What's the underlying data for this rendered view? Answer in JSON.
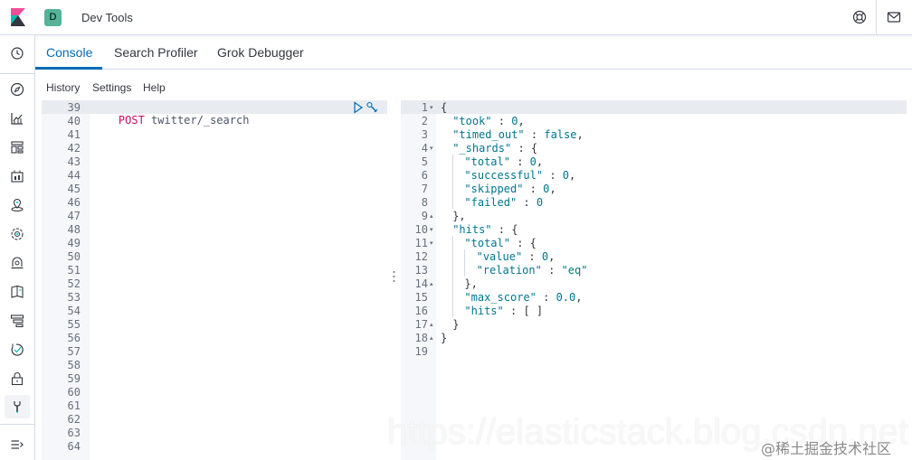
{
  "header": {
    "space_initial": "D",
    "app_title": "Dev Tools",
    "icons": [
      "kibana-logo-icon",
      "help-lifebuoy-icon",
      "mail-icon"
    ]
  },
  "sidebar": {
    "items": [
      {
        "name": "recently-viewed",
        "icon": "clock-icon"
      },
      {
        "name": "discover",
        "icon": "compass-icon"
      },
      {
        "name": "visualize",
        "icon": "chart-icon"
      },
      {
        "name": "dashboard",
        "icon": "dashboard-icon"
      },
      {
        "name": "canvas",
        "icon": "canvas-icon"
      },
      {
        "name": "maps",
        "icon": "maps-icon"
      },
      {
        "name": "machine-learning",
        "icon": "ml-icon"
      },
      {
        "name": "infrastructure",
        "icon": "infra-icon"
      },
      {
        "name": "logs",
        "icon": "logs-icon"
      },
      {
        "name": "apm",
        "icon": "apm-icon"
      },
      {
        "name": "uptime",
        "icon": "uptime-icon"
      },
      {
        "name": "siem",
        "icon": "lock-icon"
      },
      {
        "name": "dev-tools",
        "icon": "wrench-icon",
        "active": true
      },
      {
        "name": "collapse",
        "icon": "collapse-menu-icon"
      }
    ]
  },
  "tabs": [
    {
      "label": "Console",
      "active": true
    },
    {
      "label": "Search Profiler"
    },
    {
      "label": "Grok Debugger"
    }
  ],
  "menu": {
    "history": "History",
    "settings": "Settings",
    "help": "Help"
  },
  "request_editor": {
    "line_numbers": [
      "39",
      "40",
      "41",
      "42",
      "43",
      "44",
      "45",
      "46",
      "47",
      "48",
      "49",
      "50",
      "51",
      "52",
      "53",
      "54",
      "55",
      "56",
      "57",
      "58",
      "59",
      "60",
      "61",
      "62",
      "63",
      "64"
    ],
    "method": "POST",
    "path": "twitter/_search"
  },
  "response_editor": {
    "line_numbers": [
      "1",
      "2",
      "3",
      "4",
      "5",
      "6",
      "7",
      "8",
      "9",
      "10",
      "11",
      "12",
      "13",
      "14",
      "15",
      "16",
      "17",
      "18",
      "19"
    ],
    "fold_marks": [
      "▾",
      "",
      "",
      "▾",
      "",
      "",
      "",
      "",
      "▴",
      "▾",
      "▾",
      "",
      "",
      "▴",
      "",
      "",
      "▴",
      "▴",
      ""
    ],
    "lines": [
      "{",
      "\"took\" : 0,",
      "\"timed_out\" : false,",
      "\"_shards\" : {",
      "\"total\" : 0,",
      "\"successful\" : 0,",
      "\"skipped\" : 0,",
      "\"failed\" : 0",
      "},",
      "\"hits\" : {",
      "\"total\" : {",
      "\"value\" : 0,",
      "\"relation\" : \"eq\"",
      "},",
      "\"max_score\" : 0.0,",
      "\"hits\" : [ ]",
      "}",
      "}",
      ""
    ]
  },
  "watermark": {
    "url": "https://elasticstack.blog.csdn.net",
    "credit": "@稀土掘金技术社区"
  },
  "colors": {
    "accent": "#006bb4",
    "method": "#c80a68",
    "space_badge": "#54b399"
  }
}
